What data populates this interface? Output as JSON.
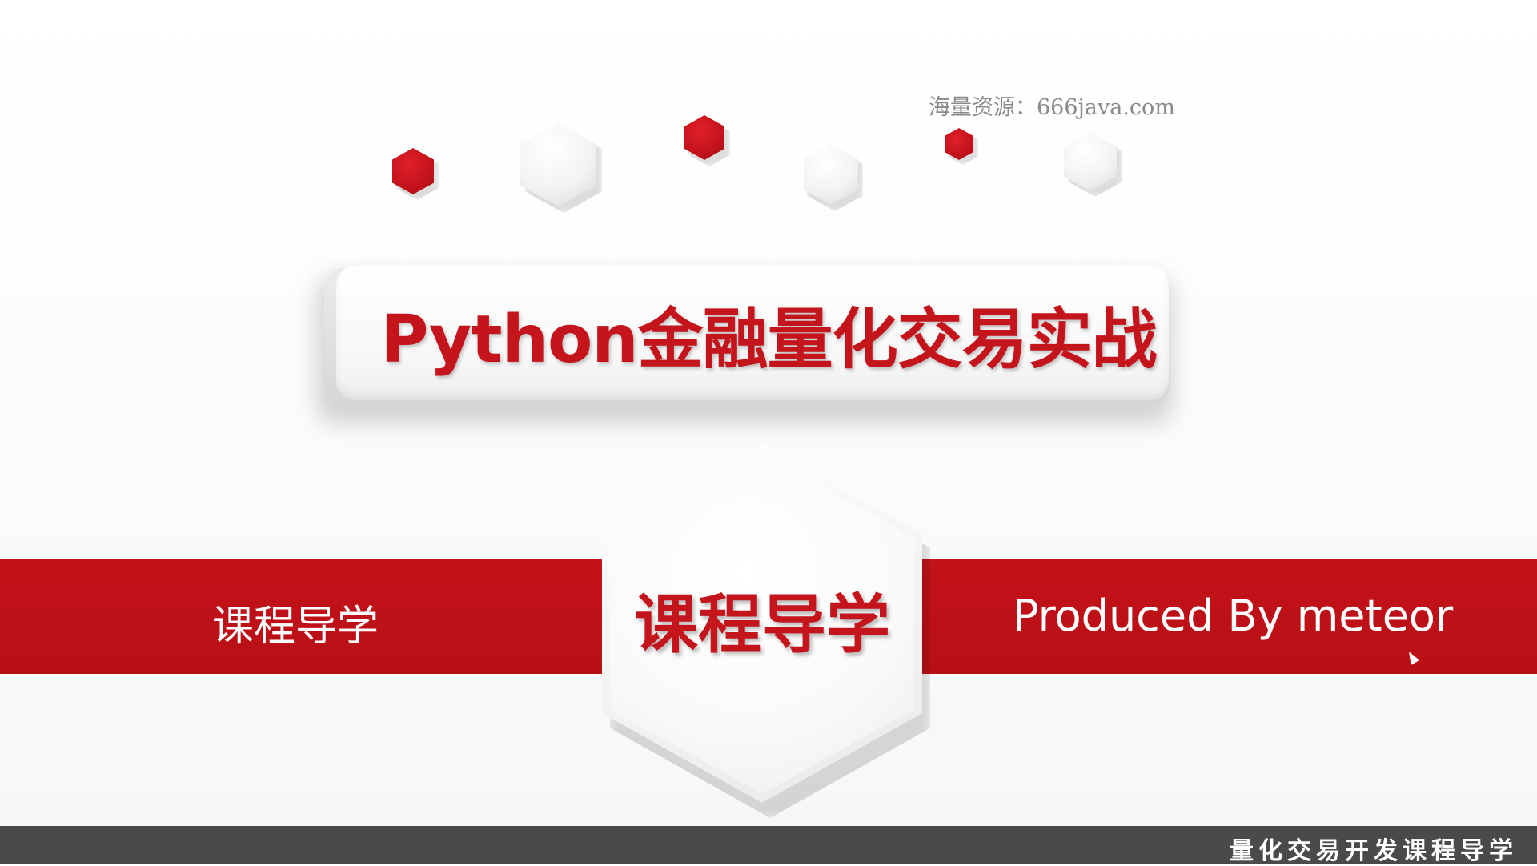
{
  "watermark": "海量资源：666java.com",
  "title": "Python金融量化交易实战",
  "hex_label": "课程导学",
  "band": {
    "left_text": "课程导学",
    "right_text": "Produced By meteor"
  },
  "subtitle": "量化交易开发课程导学",
  "colors": {
    "accent_red": "#c4141c",
    "subtitle_bar": "#4a4a4a"
  }
}
